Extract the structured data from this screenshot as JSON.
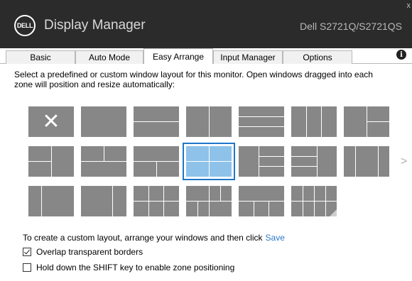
{
  "header": {
    "logo_text": "DELL",
    "title": "Display Manager",
    "model": "Dell S2721Q/S2721QS",
    "close_glyph": "x"
  },
  "tabs": [
    {
      "label": "Basic",
      "active": false
    },
    {
      "label": "Auto Mode",
      "active": false
    },
    {
      "label": "Easy Arrange",
      "active": true
    },
    {
      "label": "Input Manager",
      "active": false
    },
    {
      "label": "Options",
      "active": false
    }
  ],
  "info_icon": "info-icon",
  "instruction": "Select a predefined or custom window layout for this monitor.  Open windows dragged into each zone will position and resize automatically:",
  "layouts": {
    "clear_glyph": "✕",
    "selected_index": 10,
    "count": 20
  },
  "next_arrow": ">",
  "custom": {
    "text": "To create a custom layout, arrange your windows and then click",
    "save_label": "Save"
  },
  "options": [
    {
      "label": "Overlap transparent borders",
      "checked": true
    },
    {
      "label": "Hold down the SHIFT key to enable zone positioning",
      "checked": false
    }
  ],
  "colors": {
    "titlebar": "#2b2b2b",
    "tile": "#878787",
    "selected_tile": "#8ec2e9",
    "selected_border": "#1f77c9",
    "link": "#2b78c9"
  }
}
